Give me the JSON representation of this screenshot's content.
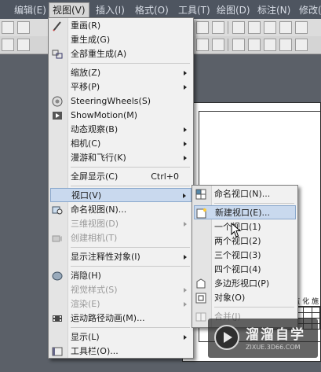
{
  "menubar": {
    "items": [
      "编辑(E)",
      "视图(V)",
      "插入(I)",
      "格式(O)",
      "工具(T)",
      "绘图(D)",
      "标注(N)",
      "修改("
    ]
  },
  "view_menu": {
    "items": [
      {
        "label": "重画(R)"
      },
      {
        "label": "重生成(G)"
      },
      {
        "label": "全部重生成(A)"
      },
      {
        "label": "缩放(Z)"
      },
      {
        "label": "平移(P)"
      },
      {
        "label": "SteeringWheels(S)"
      },
      {
        "label": "ShowMotion(M)"
      },
      {
        "label": "动态观察(B)"
      },
      {
        "label": "相机(C)"
      },
      {
        "label": "漫游和飞行(K)"
      },
      {
        "label": "全屏显示(C)",
        "shortcut": "Ctrl+0"
      },
      {
        "label": "视口(V)"
      },
      {
        "label": "命名视图(N)..."
      },
      {
        "label": "三维视图(D)"
      },
      {
        "label": "创建相机(T)"
      },
      {
        "label": "显示注释性对象(I)"
      },
      {
        "label": "消隐(H)"
      },
      {
        "label": "视觉样式(S)"
      },
      {
        "label": "渲染(E)"
      },
      {
        "label": "运动路径动画(M)..."
      },
      {
        "label": "显示(L)"
      },
      {
        "label": "工具栏(O)..."
      }
    ]
  },
  "viewport_submenu": {
    "items": [
      {
        "label": "命名视口(N)..."
      },
      {
        "label": "新建视口(E)..."
      },
      {
        "label": "一个视口(1)"
      },
      {
        "label": "两个视口(2)"
      },
      {
        "label": "三个视口(3)"
      },
      {
        "label": "四个视口(4)"
      },
      {
        "label": "多边形视口(P)"
      },
      {
        "label": "对象(O)"
      },
      {
        "label": "合并(J)"
      }
    ]
  },
  "sheet": {
    "title_text": "一 区 监 化 施"
  },
  "watermark": {
    "brand": "溜溜自学",
    "url": "ZIXUE.3D66.COM"
  }
}
